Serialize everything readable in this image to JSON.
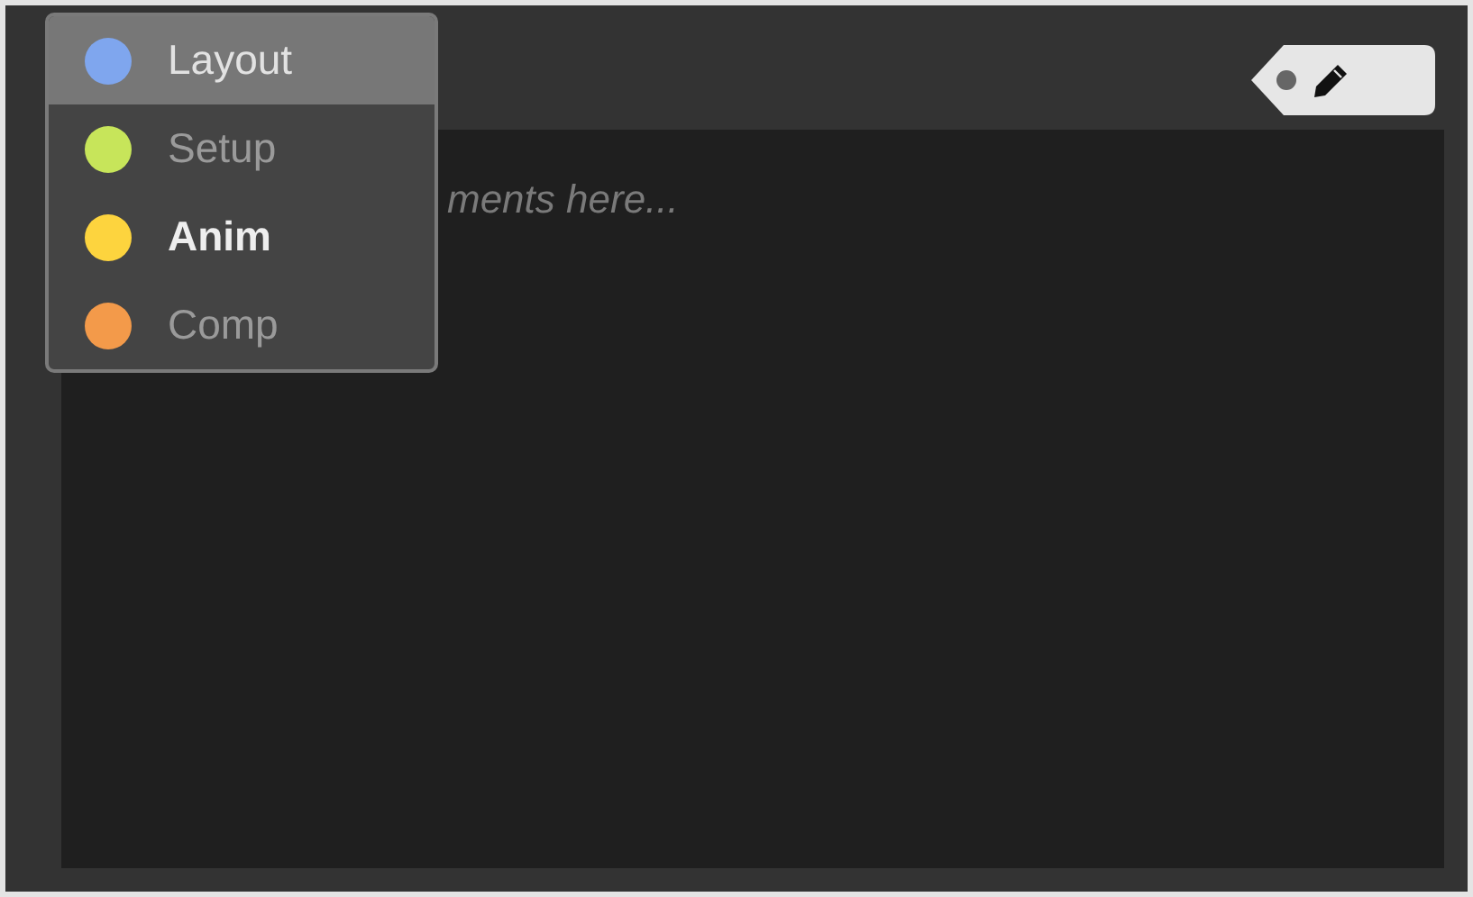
{
  "status_menu": {
    "items": [
      {
        "label": "Layout",
        "color": "#7fa6ee",
        "selected": true,
        "current": false
      },
      {
        "label": "Setup",
        "color": "#c7e55a",
        "selected": false,
        "current": false
      },
      {
        "label": "Anim",
        "color": "#fdd43e",
        "selected": false,
        "current": true
      },
      {
        "label": "Comp",
        "color": "#f39a4a",
        "selected": false,
        "current": false
      }
    ]
  },
  "comment_box": {
    "placeholder": "ments here..."
  }
}
